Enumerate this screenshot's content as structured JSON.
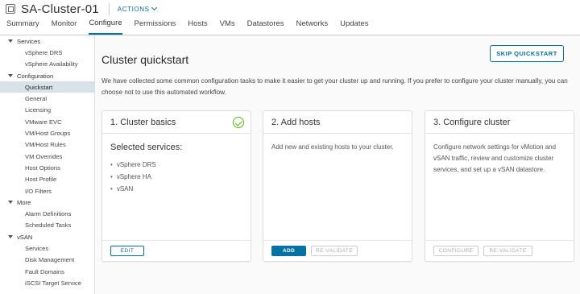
{
  "header": {
    "title": "SA-Cluster-01",
    "actions_label": "ACTIONS"
  },
  "tabs": [
    {
      "label": "Summary"
    },
    {
      "label": "Monitor"
    },
    {
      "label": "Configure"
    },
    {
      "label": "Permissions"
    },
    {
      "label": "Hosts"
    },
    {
      "label": "VMs"
    },
    {
      "label": "Datastores"
    },
    {
      "label": "Networks"
    },
    {
      "label": "Updates"
    }
  ],
  "sidebar": {
    "groups": [
      {
        "label": "Services",
        "items": [
          "vSphere DRS",
          "vSphere Availability"
        ]
      },
      {
        "label": "Configuration",
        "items": [
          "Quickstart",
          "General",
          "Licensing",
          "VMware EVC",
          "VM/Host Groups",
          "VM/Host Rules",
          "VM Overrides",
          "Host Options",
          "Host Profile",
          "I/O Filters"
        ]
      },
      {
        "label": "More",
        "items": [
          "Alarm Definitions",
          "Scheduled Tasks"
        ]
      },
      {
        "label": "vSAN",
        "items": [
          "Services",
          "Disk Management",
          "Fault Domains",
          "iSCSI Target Service"
        ]
      }
    ]
  },
  "main": {
    "title": "Cluster quickstart",
    "skip_label": "SKIP QUICKSTART",
    "intro": "We have collected some common configuration tasks to make it easier to get your cluster up and running. If you prefer to configure your cluster manually, you can choose not to use this automated workflow.",
    "cards": [
      {
        "title": "1. Cluster basics",
        "subtitle": "Selected services:",
        "services": [
          "vSphere DRS",
          "vSphere HA",
          "vSAN"
        ],
        "edit_label": "EDIT"
      },
      {
        "title": "2. Add hosts",
        "description": "Add new and existing hosts to your cluster.",
        "add_label": "ADD",
        "revalidate_label": "RE-VALIDATE"
      },
      {
        "title": "3. Configure cluster",
        "description": "Configure network settings for vMotion and vSAN traffic, review and customize cluster services, and set up a vSAN datastore.",
        "configure_label": "CONFIGURE",
        "revalidate_label": "RE-VALIDATE"
      }
    ]
  },
  "colors": {
    "accent": "#0072a3",
    "success": "#5eb715",
    "sidebar_active": "#d8e3e9"
  }
}
